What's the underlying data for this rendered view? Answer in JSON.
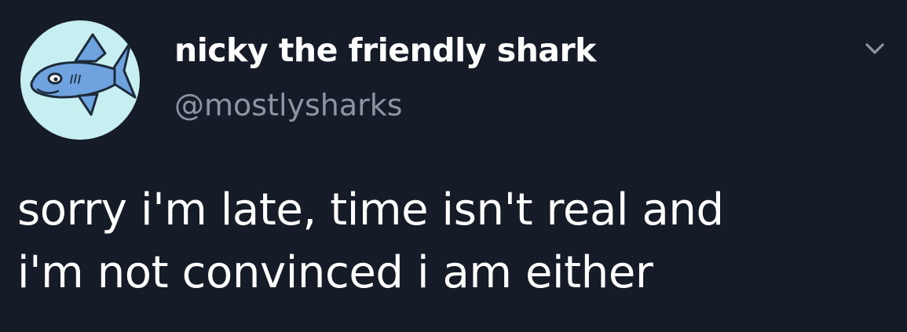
{
  "author": {
    "display_name": "nicky the friendly shark",
    "handle": "@mostlysharks",
    "avatar_icon": "shark-cartoon-icon"
  },
  "tweet": {
    "lines": [
      "sorry i'm late, time isn't real and",
      "i'm not convinced i am either"
    ]
  },
  "menu": {
    "icon": "chevron-down-icon"
  },
  "colors": {
    "background": "#151c28",
    "text": "#ffffff",
    "handle": "#8a96a3",
    "avatar_bg": "#c7eef0",
    "shark": "#6fa3df"
  }
}
